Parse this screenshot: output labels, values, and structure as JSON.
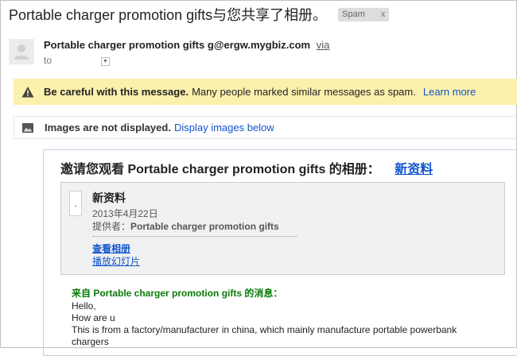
{
  "email": {
    "subject": "Portable charger promotion gifts与您共享了相册。",
    "spam_label": "Spam",
    "spam_remove": "x",
    "sender_name": "Portable charger promotion gifts",
    "sender_email": "g@ergw.mygbiz.com",
    "via": "via",
    "to_label": "to"
  },
  "warning": {
    "bold": "Be careful with this message.",
    "text": "Many people marked similar messages as spam.",
    "link": "Learn more",
    "icon": "warning-icon"
  },
  "images_bar": {
    "bold": "Images are not displayed.",
    "link": "Display images below",
    "icon": "image-icon"
  },
  "body": {
    "invite_text": "邀请您观看 Portable charger promotion gifts 的相册：",
    "invite_link": "新资料",
    "album": {
      "thumb_text": ".",
      "title": "新资料",
      "date": "2013年4月22日",
      "provider_label": "提供者：",
      "provider_name": "Portable charger promotion gifts",
      "view_link": "查看相册",
      "slideshow_link": "播放幻灯片"
    },
    "message_header": "来自 Portable charger promotion gifts 的消息：",
    "message_lines": [
      "Hello,",
      "How are u",
      "This is from a factory/manufacturer in china, which mainly manufacture portable powerbank",
      "chargers"
    ]
  },
  "colors": {
    "link": "#1155cc",
    "warning_bg": "#fcf0ad",
    "message_header": "#0a7a0a"
  }
}
